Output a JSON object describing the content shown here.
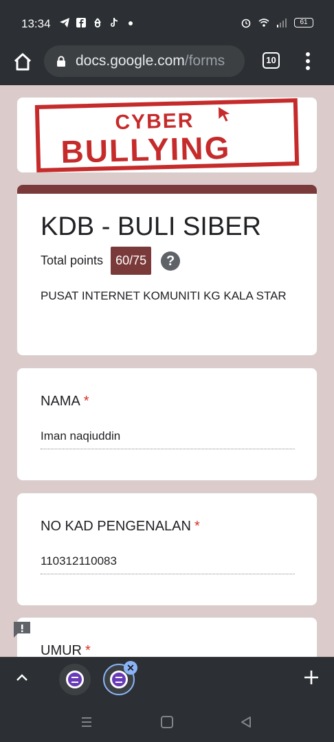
{
  "status": {
    "time": "13:34",
    "battery": "61"
  },
  "browser": {
    "url_host": "docs.google.com",
    "url_path": "/forms",
    "tab_count": "10"
  },
  "banner": {
    "line1": "CYBER",
    "line2": "BULLYING",
    "color": "#c62b2b"
  },
  "form": {
    "title": "KDB - BULI SIBER",
    "points_label": "Total points",
    "points_value": "60/75",
    "help": "?",
    "description": "PUSAT INTERNET KOMUNITI KG KALA STAR",
    "theme_color": "#7b3a3a",
    "background_color": "#dccbcb"
  },
  "questions": [
    {
      "label": "NAMA",
      "required": "*",
      "answer": "Iman naqiuddin"
    },
    {
      "label": "NO KAD PENGENALAN",
      "required": "*",
      "answer": "110312110083"
    },
    {
      "label": "UMUR",
      "required": "*",
      "answer": ""
    }
  ],
  "tab_strip": {
    "close": "✕",
    "accent": "#8ab4f8"
  },
  "icons": [
    "home-icon",
    "lock-icon",
    "menu-icon",
    "help-icon",
    "feedback-icon",
    "chevron-up-icon",
    "forms-icon",
    "close-icon",
    "plus-icon",
    "recent-apps-icon",
    "home-nav-icon",
    "back-icon"
  ]
}
